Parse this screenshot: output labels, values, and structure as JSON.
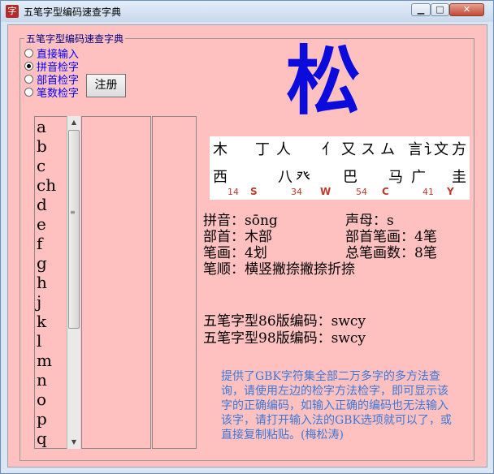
{
  "window": {
    "title": "五笔字型编码速查字典",
    "icon_label": "字",
    "minimize_label": "▁",
    "maximize_label": "□",
    "close_label": "✕"
  },
  "group": {
    "label": "五笔字型编码速查字典"
  },
  "modes": [
    {
      "label": "直接输入",
      "selected": false
    },
    {
      "label": "拼音检字",
      "selected": true
    },
    {
      "label": "部首检字",
      "selected": false
    },
    {
      "label": "笔数检字",
      "selected": false
    }
  ],
  "register_button": "注册",
  "character": "松",
  "letters": [
    "a",
    "b",
    "c",
    "ch",
    "d",
    "e",
    "f",
    "g",
    "h",
    "j",
    "k",
    "l",
    "m",
    "n",
    "o",
    "p",
    "q"
  ],
  "root_chart": {
    "row1": [
      "木",
      "丁",
      "人",
      "亻",
      "又",
      "ス",
      "ム",
      "言",
      "讠",
      "文",
      "方"
    ],
    "row2": [
      "西",
      "八",
      "癶",
      "巴",
      "马",
      "广",
      "圭"
    ],
    "codes": [
      {
        "num": "14",
        "key": "S"
      },
      {
        "num": "34",
        "key": "W"
      },
      {
        "num": "54",
        "key": "C"
      },
      {
        "num": "41",
        "key": "Y"
      }
    ]
  },
  "info": {
    "pinyin": "拼音：sōng",
    "initial": "声母：s",
    "radical": "部首：木部",
    "radical_strokes": "部首笔画：4笔",
    "strokes": "笔画：4划",
    "total_strokes": "总笔画数：8笔",
    "stroke_order": "笔顺：横竖撇捺撇捺折捺",
    "code86": "五笔字型86版编码：swcy",
    "code98": "五笔字型98版编码：swcy"
  },
  "note": "提供了GBK字符集全部二万多字的多方法查询，请使用左边的检字方法检字，即可显示该字的正确编码，如输入正确的编码也无法输入该字，请打开输入法的GBK选项就可以了，或直接复制粘贴。(梅松涛)"
}
